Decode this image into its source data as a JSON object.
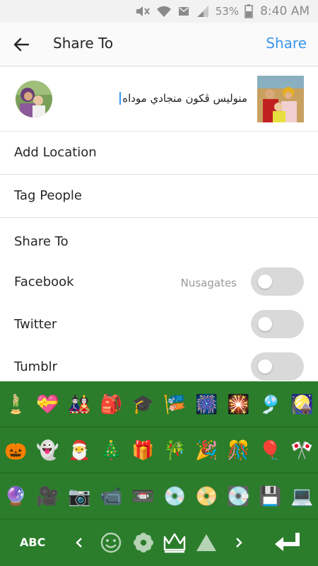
{
  "status_bar": {
    "battery": "53%",
    "time": "8:40 AM"
  },
  "app_bar": {
    "title": "Share To",
    "action": "Share"
  },
  "caption": {
    "text": "منوليس ڤكون منجادي موداه"
  },
  "rows": [
    {
      "label": "Add Location"
    },
    {
      "label": "Tag People"
    }
  ],
  "share_to": {
    "header": "Share To",
    "items": [
      {
        "label": "Facebook",
        "account": "Nusagates",
        "enabled": false
      },
      {
        "label": "Twitter",
        "account": "",
        "enabled": false
      },
      {
        "label": "Tumblr",
        "account": "",
        "enabled": false
      }
    ]
  },
  "keyboard": {
    "emoji_rows": [
      [
        "🎍",
        "💝",
        "🎎",
        "🎒",
        "🎓",
        "🎏",
        "🎆",
        "🎇",
        "🎐",
        "🎑"
      ],
      [
        "🎃",
        "👻",
        "🎅",
        "🎄",
        "🎁",
        "🎋",
        "🎉",
        "🎊",
        "🎈",
        "🎌"
      ],
      [
        "🔮",
        "🎥",
        "📷",
        "📹",
        "📼",
        "💿",
        "📀",
        "💽",
        "💾",
        "💻"
      ]
    ],
    "abc_label": "ABC"
  },
  "colors": {
    "accent": "#3897f0",
    "keyboard_bg": "#2b7d2b",
    "toggle_off": "#d9d9d9"
  }
}
